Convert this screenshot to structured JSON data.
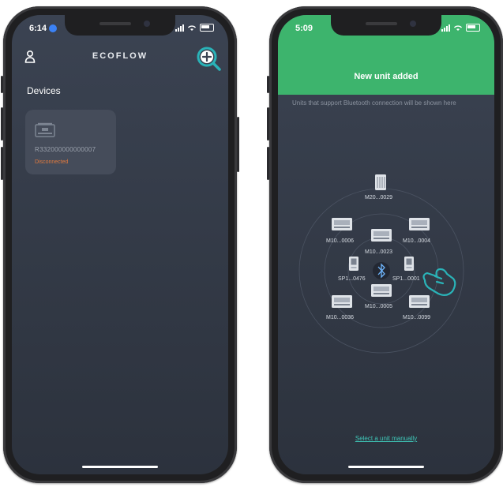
{
  "left_phone": {
    "status": {
      "time": "6:14"
    },
    "header": {
      "logo": "ECOFLOW",
      "add_icon": "plus-circle-icon",
      "user_icon": "user-icon"
    },
    "devices_title": "Devices",
    "device": {
      "serial": "R332000000000007",
      "state": "Disconnected",
      "icon": "power-station-icon"
    }
  },
  "right_phone": {
    "status": {
      "time": "5:09"
    },
    "banner_title": "New unit added",
    "hint": "Units that support Bluetooth connection will be shown here",
    "units": [
      {
        "label": "M20...0029",
        "kind": "tall"
      },
      {
        "label": "M10...0006",
        "kind": "wide"
      },
      {
        "label": "M10...0023",
        "kind": "wide"
      },
      {
        "label": "M10...0004",
        "kind": "wide"
      },
      {
        "label": "SP1...0476",
        "kind": "small"
      },
      {
        "label": "SP1...0001",
        "kind": "small"
      },
      {
        "label": "M10...0005",
        "kind": "wide"
      },
      {
        "label": "M10...0036",
        "kind": "wide"
      },
      {
        "label": "M10...0099",
        "kind": "wide"
      }
    ],
    "manual_link": "Select a unit manually",
    "center_icon": "bluetooth-icon",
    "pointer_icon": "hand-pointer-icon"
  },
  "colors": {
    "accent_green": "#3db46d",
    "link_teal": "#3fc7b8",
    "highlight": "#2ab3b8",
    "disconnected": "#e07a3f"
  }
}
